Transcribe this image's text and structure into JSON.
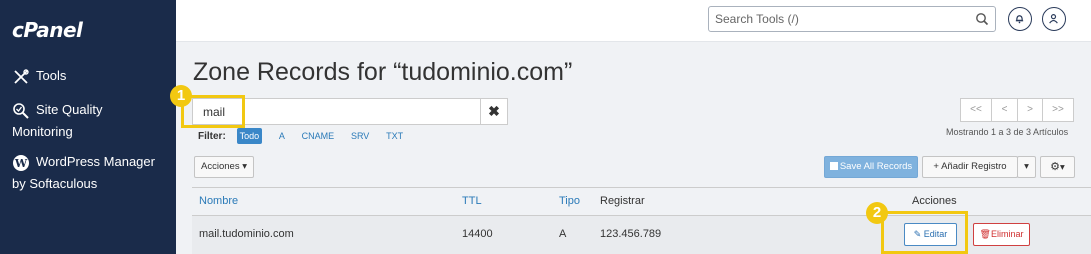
{
  "sidebar": {
    "logo": "cPanel",
    "items": [
      {
        "label": "Tools",
        "icon": "tools-icon"
      },
      {
        "label": "Site Quality Monitoring",
        "line1": "Site Quality",
        "line2": "Monitoring",
        "icon": "site-quality-icon"
      },
      {
        "label": "WordPress Manager by Softaculous",
        "line1": "WordPress Manager",
        "line2": "by Softaculous",
        "icon": "wordpress-icon"
      }
    ]
  },
  "header": {
    "search_placeholder": "Search Tools (/)",
    "icons": [
      "search-icon",
      "bell-icon",
      "user-icon"
    ]
  },
  "page": {
    "title": "Zone Records for “tudominio.com”",
    "filter_value": "mail",
    "filter_clear": "✖",
    "filter_label": "Filter:",
    "filter_options": [
      "Todo",
      "A",
      "CNAME",
      "SRV",
      "TXT"
    ],
    "active_filter": "Todo",
    "pager": [
      "<<",
      "<",
      ">",
      ">>"
    ],
    "results_text": "Mostrando 1 a 3 de 3 Artículos"
  },
  "toolbar": {
    "actions_label": "Acciones ▾",
    "save_all_label": "Save All Records",
    "add_record_label": "+ Añadir Registro",
    "add_record_caret": "▾",
    "settings_caret": "▾"
  },
  "table": {
    "columns": [
      "Nombre",
      "TTL",
      "Tipo",
      "Registrar",
      "Acciones"
    ],
    "rows": [
      {
        "name": "mail.tudominio.com",
        "ttl": "14400",
        "type": "A",
        "record": "123.456.789",
        "edit_label": "Editar",
        "delete_label": "Eliminar"
      }
    ]
  },
  "annotations": {
    "markers": [
      "1",
      "2"
    ],
    "highlight_color": "#f2c811"
  },
  "colors": {
    "sidebar_bg": "#1a2b4a",
    "link": "#2a7ab8",
    "active_filter_bg": "#3a87c8",
    "delete": "#d03030"
  }
}
